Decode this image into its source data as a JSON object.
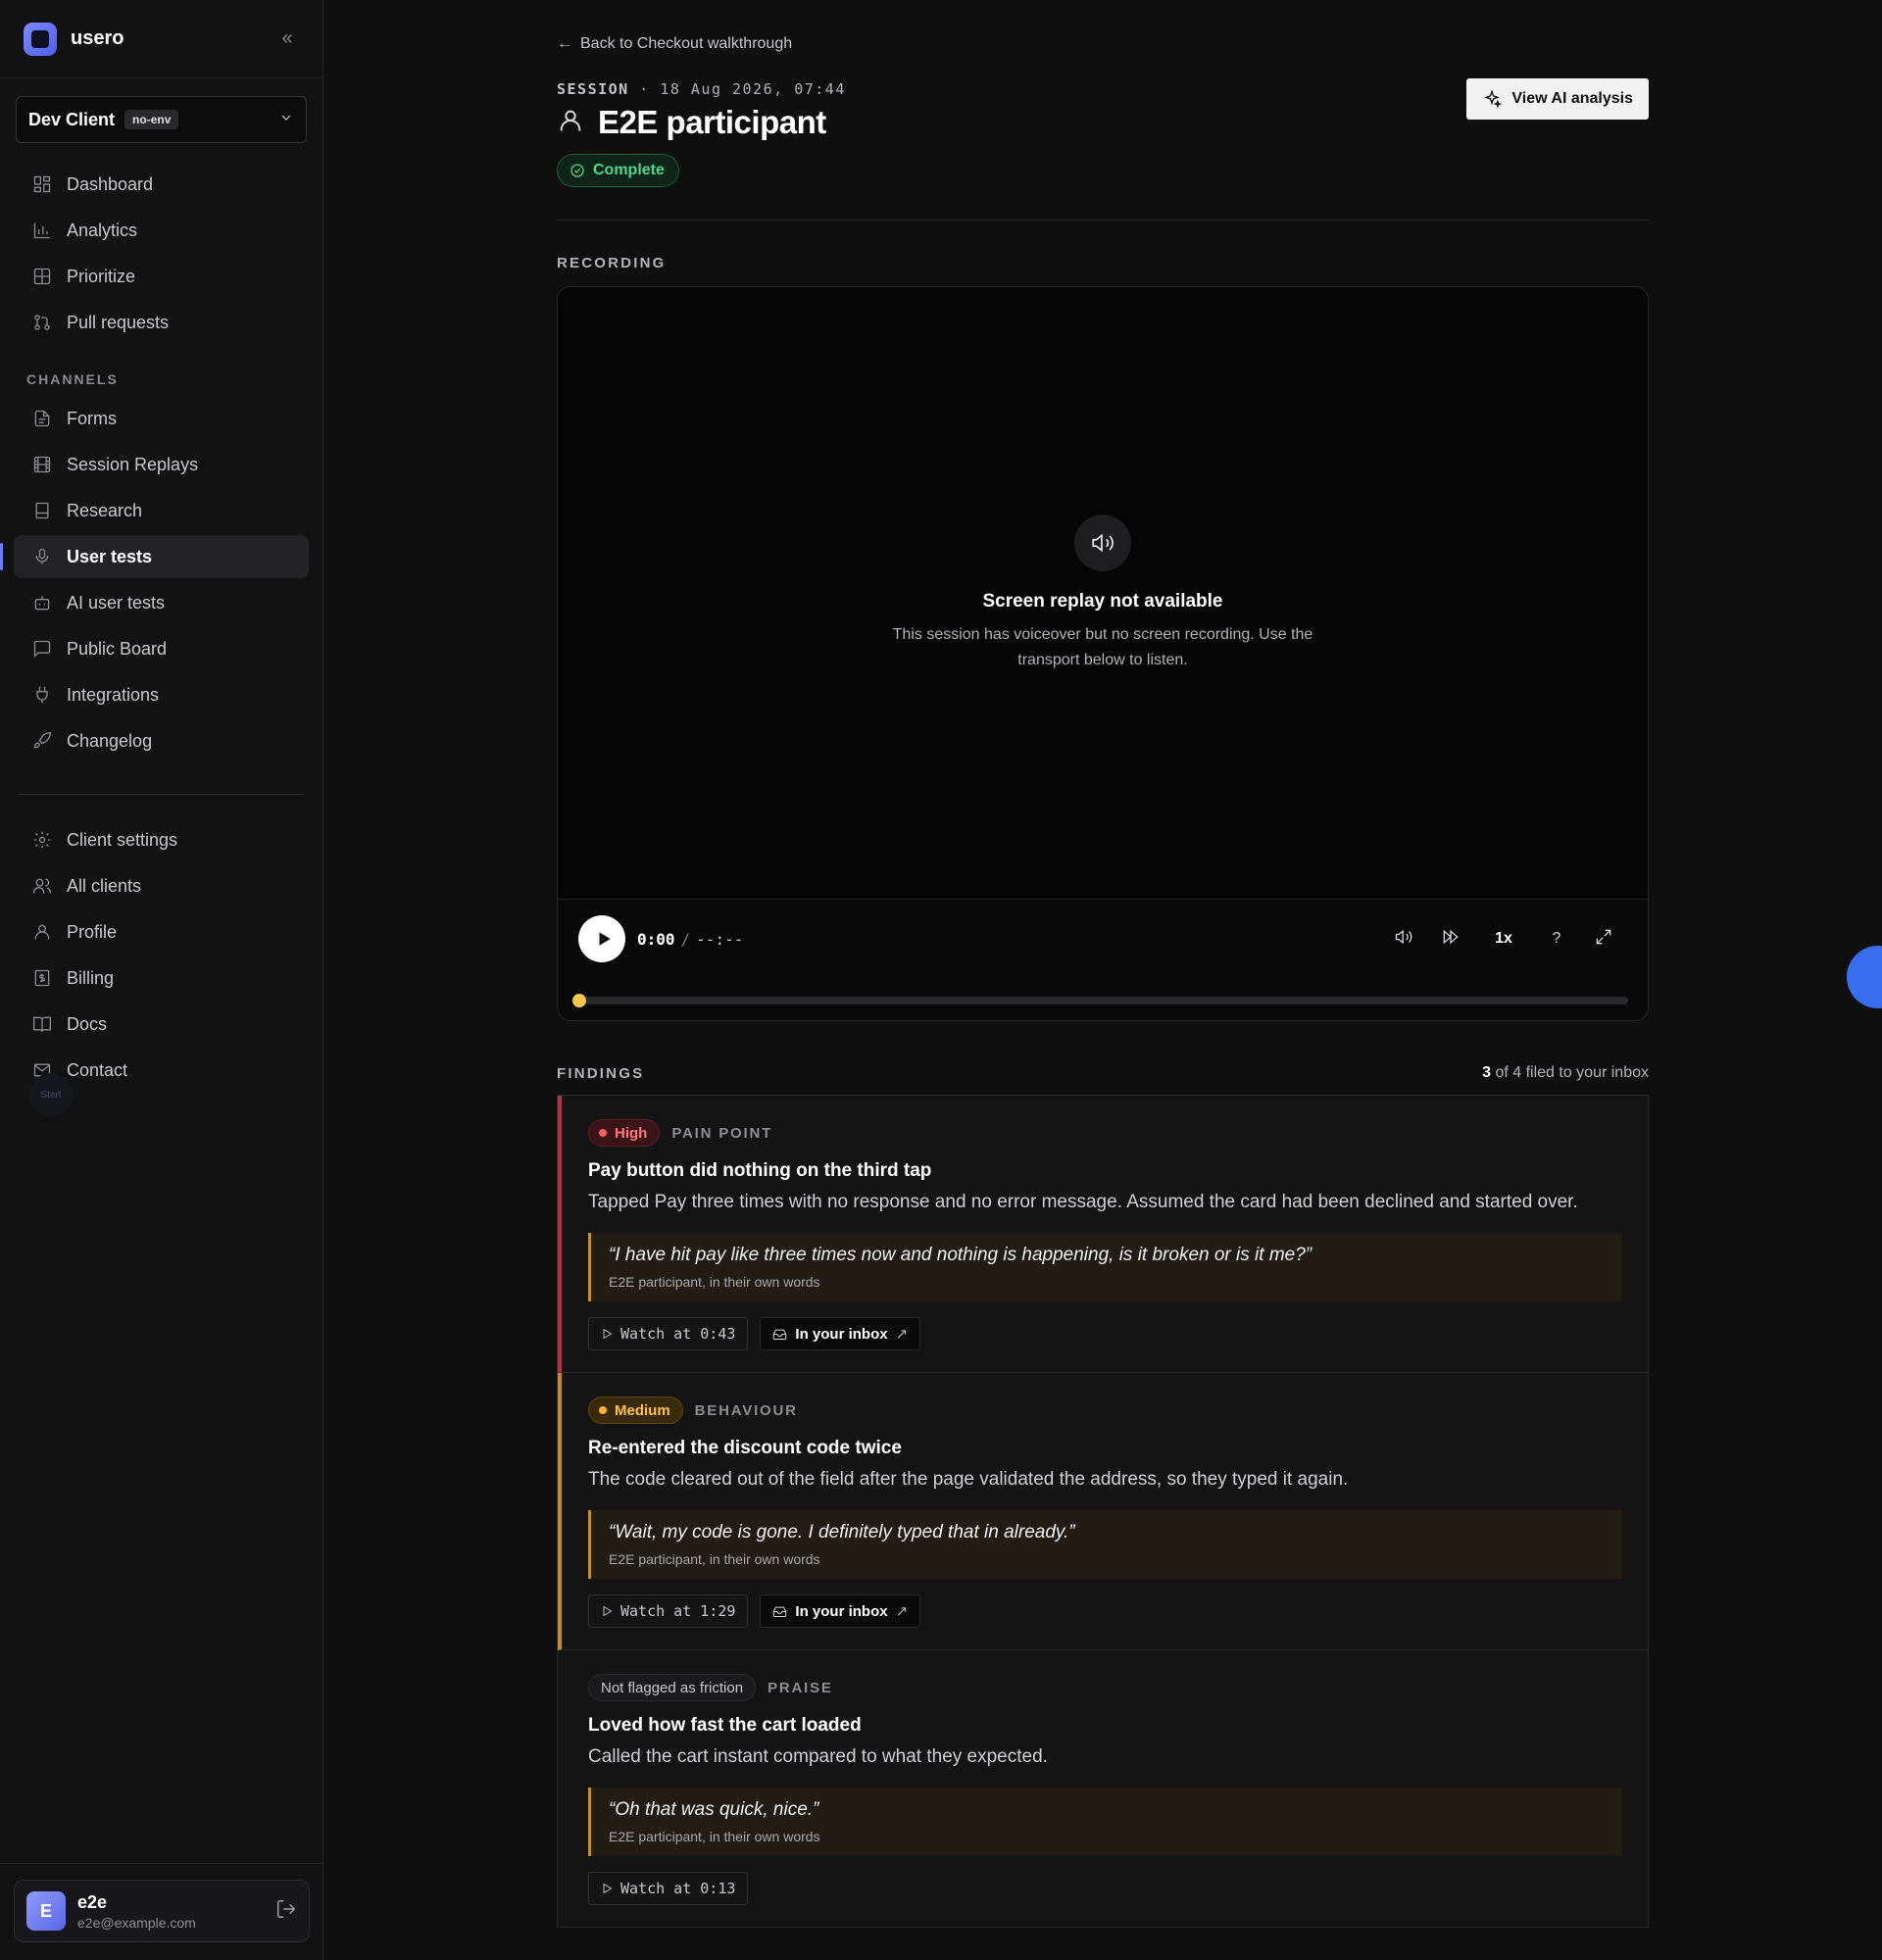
{
  "brand": {
    "name": "usero"
  },
  "client": {
    "name": "Dev Client",
    "env": "no-env"
  },
  "nav": {
    "main": [
      {
        "label": "Dashboard",
        "icon": "dashboard-icon"
      },
      {
        "label": "Analytics",
        "icon": "bar-chart-icon"
      },
      {
        "label": "Prioritize",
        "icon": "grid-icon"
      },
      {
        "label": "Pull requests",
        "icon": "git-pull-request-icon"
      }
    ],
    "channels_label": "CHANNELS",
    "channels": [
      {
        "label": "Forms",
        "icon": "form-icon"
      },
      {
        "label": "Session Replays",
        "icon": "film-icon"
      },
      {
        "label": "Research",
        "icon": "bookmark-icon"
      },
      {
        "label": "User tests",
        "icon": "microphone-icon",
        "active": true
      },
      {
        "label": "AI user tests",
        "icon": "bot-icon"
      },
      {
        "label": "Public Board",
        "icon": "message-square-icon"
      },
      {
        "label": "Integrations",
        "icon": "plug-icon"
      },
      {
        "label": "Changelog",
        "icon": "rocket-icon"
      }
    ],
    "settings": [
      {
        "label": "Client settings",
        "icon": "gear-icon"
      },
      {
        "label": "All clients",
        "icon": "users-icon"
      },
      {
        "label": "Profile",
        "icon": "user-icon"
      },
      {
        "label": "Billing",
        "icon": "dollar-icon"
      },
      {
        "label": "Docs",
        "icon": "book-icon"
      },
      {
        "label": "Contact",
        "icon": "mail-icon"
      }
    ],
    "start_label": "Start"
  },
  "user": {
    "initial": "E",
    "name": "e2e",
    "email": "e2e@example.com"
  },
  "page": {
    "back_label": "Back to Checkout walkthrough",
    "session_label": "SESSION",
    "session_date": "18 Aug 2026, 07:44",
    "title": "E2E participant",
    "status": "Complete",
    "ai_button": "View AI analysis"
  },
  "recording": {
    "section_label": "RECORDING",
    "unavailable_title": "Screen replay not available",
    "unavailable_desc": "This session has voiceover but no screen recording. Use the transport below to listen.",
    "current_time": "0:00",
    "time_sep": "/",
    "duration": "--:--",
    "speed": "1x",
    "help": "?",
    "progress": 0
  },
  "findings": {
    "section_label": "FINDINGS",
    "filed_count": "3",
    "filed_rest": "of 4 filed to your inbox",
    "items": [
      {
        "severity": "High",
        "type": "PAIN POINT",
        "title": "Pay button did nothing on the third tap",
        "desc": "Tapped Pay three times with no response and no error message. Assumed the card had been declined and started over.",
        "quote": "“I have hit pay like three times now and nothing is happening, is it broken or is it me?”",
        "attribution": "E2E participant, in their own words",
        "watch": "Watch at 0:43",
        "inbox": "In your inbox"
      },
      {
        "severity": "Medium",
        "type": "BEHAVIOUR",
        "title": "Re-entered the discount code twice",
        "desc": "The code cleared out of the field after the page validated the address, so they typed it again.",
        "quote": "“Wait, my code is gone. I definitely typed that in already.”",
        "attribution": "E2E participant, in their own words",
        "watch": "Watch at 1:29",
        "inbox": "In your inbox"
      },
      {
        "severity": "Not flagged as friction",
        "type": "PRAISE",
        "title": "Loved how fast the cart loaded",
        "desc": "Called the cart instant compared to what they expected.",
        "quote": "“Oh that was quick, nice.”",
        "attribution": "E2E participant, in their own words",
        "watch": "Watch at 0:13"
      }
    ]
  }
}
